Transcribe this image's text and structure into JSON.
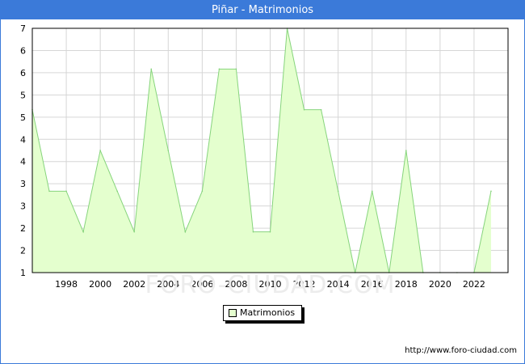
{
  "title": "Piñar - Matrimonios",
  "source": "http://www.foro-ciudad.com",
  "watermark": "FORO-CIUDAD.COM",
  "colors": {
    "titlebar": "#3b7ad9",
    "fill": "#e4ffce",
    "line": "#86d47c",
    "grid": "#d6d6d6"
  },
  "chart_data": {
    "type": "area",
    "title": "Piñar - Matrimonios",
    "xlabel": "",
    "ylabel": "",
    "x": [
      1996,
      1997,
      1998,
      1999,
      2000,
      2001,
      2002,
      2003,
      2004,
      2005,
      2006,
      2007,
      2008,
      2009,
      2010,
      2011,
      2012,
      2013,
      2014,
      2015,
      2016,
      2017,
      2018,
      2019,
      2020,
      2021,
      2022,
      2023
    ],
    "series": [
      {
        "name": "Matrimonios",
        "values": [
          5,
          3,
          3,
          2,
          4,
          3,
          2,
          6,
          4,
          2,
          3,
          6,
          6,
          2,
          2,
          7,
          5,
          5,
          3,
          1,
          3,
          1,
          4,
          0,
          0,
          0,
          0,
          3
        ]
      }
    ],
    "xlim": [
      1996,
      2024
    ],
    "ylim": [
      1,
      7
    ],
    "x_ticks": [
      1998,
      2000,
      2002,
      2004,
      2006,
      2008,
      2010,
      2012,
      2014,
      2016,
      2018,
      2020,
      2022
    ],
    "y_tick_labels": [
      "1",
      "2",
      "2",
      "3",
      "3",
      "4",
      "4",
      "5",
      "5",
      "6",
      "6",
      "7"
    ],
    "grid": true,
    "legend_position": "bottom-center"
  }
}
